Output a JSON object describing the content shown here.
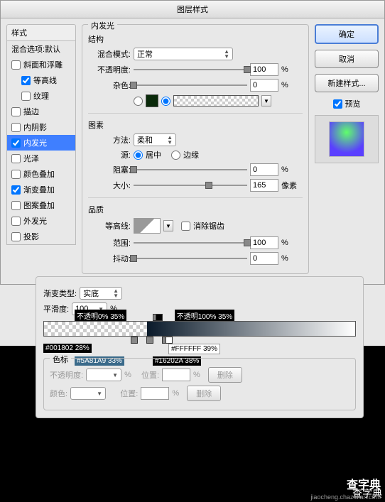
{
  "title": "图层样式",
  "styles": {
    "header": "样式",
    "blend_default": "混合选项:默认",
    "items": [
      {
        "label": "斜面和浮雕",
        "checked": false
      },
      {
        "label": "等高线",
        "checked": true,
        "indent": true
      },
      {
        "label": "纹理",
        "checked": false,
        "indent": true
      },
      {
        "label": "描边",
        "checked": false
      },
      {
        "label": "内阴影",
        "checked": false
      },
      {
        "label": "内发光",
        "checked": true,
        "selected": true
      },
      {
        "label": "光泽",
        "checked": false
      },
      {
        "label": "颜色叠加",
        "checked": false
      },
      {
        "label": "渐变叠加",
        "checked": true
      },
      {
        "label": "图案叠加",
        "checked": false
      },
      {
        "label": "外发光",
        "checked": false
      },
      {
        "label": "投影",
        "checked": false
      }
    ]
  },
  "inner_glow": {
    "title": "内发光",
    "structure": {
      "legend": "结构",
      "blend_mode_label": "混合模式:",
      "blend_mode_value": "正常",
      "opacity_label": "不透明度:",
      "opacity_value": "100",
      "opacity_unit": "%",
      "noise_label": "杂色:",
      "noise_value": "0",
      "noise_unit": "%",
      "solid_color": "#0a2a0a"
    },
    "elements": {
      "legend": "图素",
      "technique_label": "方法:",
      "technique_value": "柔和",
      "source_label": "源:",
      "source_center": "居中",
      "source_edge": "边缘",
      "choke_label": "阻塞:",
      "choke_value": "0",
      "choke_unit": "%",
      "size_label": "大小:",
      "size_value": "165",
      "size_unit": "像素"
    },
    "quality": {
      "legend": "品质",
      "contour_label": "等高线:",
      "antialias_label": "消除锯齿",
      "range_label": "范围:",
      "range_value": "100",
      "range_unit": "%",
      "jitter_label": "抖动:",
      "jitter_value": "0",
      "jitter_unit": "%"
    }
  },
  "gradient_editor": {
    "type_label": "渐变类型:",
    "type_value": "实底",
    "smoothness_label": "平滑度:",
    "smoothness_value": "100",
    "smoothness_unit": "%",
    "opacity_stop_left": "不透明0% 35%",
    "opacity_stop_right": "不透明100% 35%",
    "color_stop_1": "#001802 28%",
    "color_stop_2": "#5A81A9 33%",
    "color_stop_3": "#16202A 38%",
    "color_stop_4": "#FFFFFF 39%",
    "stops_legend": "色标",
    "opacity_label": "不透明度:",
    "position_label": "位置:",
    "delete_label": "删除",
    "color_label": "颜色:",
    "percent": "%"
  },
  "buttons": {
    "ok": "确定",
    "cancel": "取消",
    "new_style": "新建样式...",
    "preview": "预览"
  },
  "watermark": "查字典",
  "watermark_sub": "jiaocheng.chazidian.com"
}
